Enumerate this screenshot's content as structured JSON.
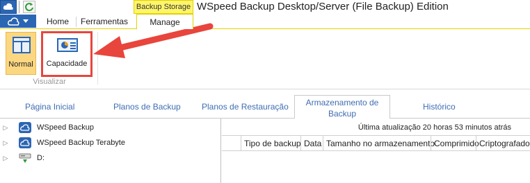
{
  "titlebar": {
    "context_label": "Backup Storage",
    "app_title": "WSpeed Backup Desktop/Server (File Backup) Edition"
  },
  "ribbon_tabs": [
    {
      "label": "Home"
    },
    {
      "label": "Ferramentas"
    },
    {
      "label": "Manage"
    }
  ],
  "ribbon": {
    "normal_label": "Normal",
    "capacity_label": "Capacidade",
    "group_label": "Visualizar"
  },
  "nav_tabs": [
    {
      "label": "Página Inicial"
    },
    {
      "label": "Planos de Backup"
    },
    {
      "label": "Planos de Restauração"
    },
    {
      "label": "Armazenamento de Backup"
    },
    {
      "label": "Histórico"
    }
  ],
  "tree": {
    "items": [
      {
        "label": "WSpeed Backup",
        "icon": "cloud-storage-icon"
      },
      {
        "label": "WSpeed Backup Terabyte",
        "icon": "cloud-storage-icon"
      },
      {
        "label": "D:",
        "icon": "drive-icon"
      }
    ]
  },
  "details": {
    "last_update": "Última atualização 20 horas 53 minutos atrás",
    "columns": [
      "Tipo de backup",
      "Data",
      "Tamanho no armazenamento",
      "Comprimido",
      "Criptografado"
    ]
  },
  "colors": {
    "accent_blue": "#2b66b3",
    "context_yellow": "#fff56b",
    "highlight_red": "#e8453c",
    "selected_orange": "#fcd782"
  }
}
